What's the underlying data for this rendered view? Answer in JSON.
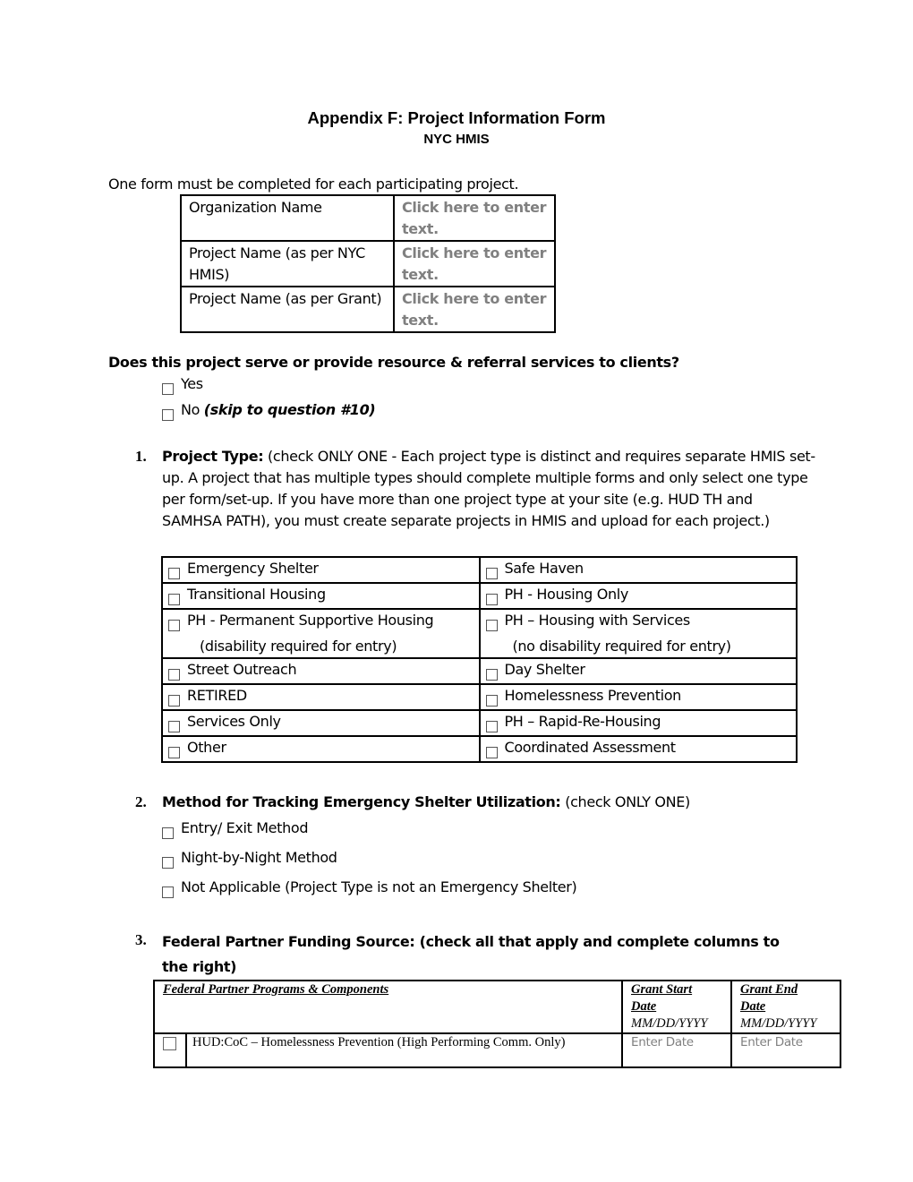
{
  "header": {
    "title": "Appendix F: Project Information Form",
    "subtitle": "NYC HMIS"
  },
  "intro": "One form must be completed for each participating project.",
  "info_table": {
    "rows": [
      {
        "label": "Organization Name",
        "value_placeholder": "Click here to enter text."
      },
      {
        "label": "Project Name (as per NYC HMIS)",
        "value_placeholder": "Click here to enter text."
      },
      {
        "label": "Project Name (as per Grant)",
        "value_placeholder": "Click here to enter text."
      }
    ]
  },
  "services_question": {
    "text": "Does this project serve or provide resource & referral services to clients?",
    "options": [
      {
        "label": "Yes",
        "note": "",
        "checked": false
      },
      {
        "label": "No ",
        "note": "(skip to question #10)",
        "checked": false
      }
    ]
  },
  "q1": {
    "number": "1.",
    "title": "Project Type:",
    "text": " (check ONLY ONE - Each project type is distinct and requires separate HMIS set-up.  A project that has multiple types should complete multiple forms and only select one type per form/set-up. If you have more than one project type at your site (e.g. HUD TH and SAMHSA PATH), you must create separate projects in HMIS and upload for each project.)",
    "rows": [
      [
        {
          "label": "Emergency Shelter",
          "sub": ""
        },
        {
          "label": "Safe Haven",
          "sub": ""
        }
      ],
      [
        {
          "label": "Transitional Housing",
          "sub": ""
        },
        {
          "label": "PH -  Housing Only",
          "sub": ""
        }
      ],
      [
        {
          "label": "PH - Permanent Supportive Housing",
          "sub": "(disability required for entry)"
        },
        {
          "label": "PH – Housing with Services",
          "sub": "(no disability required for entry)"
        }
      ],
      [
        {
          "label": "Street Outreach",
          "sub": ""
        },
        {
          "label": "Day Shelter",
          "sub": ""
        }
      ],
      [
        {
          "label": "RETIRED",
          "sub": ""
        },
        {
          "label": "Homelessness Prevention",
          "sub": ""
        }
      ],
      [
        {
          "label": "Services Only",
          "sub": ""
        },
        {
          "label": "PH – Rapid-Re-Housing",
          "sub": ""
        }
      ],
      [
        {
          "label": "Other",
          "sub": ""
        },
        {
          "label": "Coordinated Assessment",
          "sub": ""
        }
      ]
    ]
  },
  "q2": {
    "number": "2.",
    "title": "Method for Tracking Emergency Shelter Utilization:",
    "text": " (check ONLY ONE)",
    "options": [
      {
        "label": "Entry/ Exit Method",
        "checked": false
      },
      {
        "label": "Night-by-Night Method",
        "checked": false
      },
      {
        "label": "Not Applicable (Project Type is not an Emergency Shelter)",
        "checked": false
      }
    ]
  },
  "q3": {
    "number": "3.",
    "title": "Federal Partner Funding Source: (check all that apply and complete columns to the right)",
    "table": {
      "headers": {
        "programs": "Federal Partner Programs & Components",
        "start_line1": "Grant Start",
        "start_line2": "Date",
        "end_line1": "Grant End",
        "end_line2": "Date",
        "date_format": "MM/DD/YYYY"
      },
      "rows": [
        {
          "program": "HUD:CoC – Homelessness Prevention (High Performing Comm. Only)",
          "start_placeholder": "Enter Date",
          "end_placeholder": "Enter Date",
          "checked": false
        }
      ]
    }
  }
}
